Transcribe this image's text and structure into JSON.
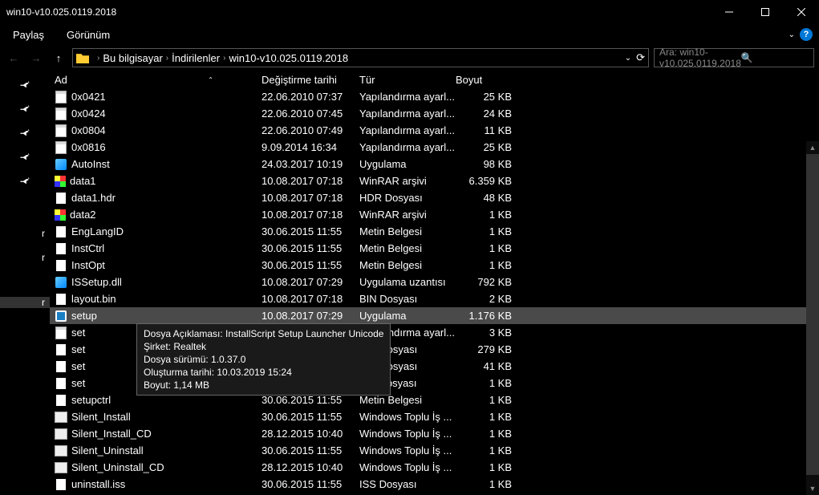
{
  "window": {
    "title": "win10-v10.025.0119.2018"
  },
  "menubar": {
    "share": "Paylaş",
    "view": "Görünüm"
  },
  "breadcrumb": {
    "seg1": "Bu bilgisayar",
    "seg2": "İndirilenler",
    "seg3": "win10-v10.025.0119.2018"
  },
  "search": {
    "placeholder": "Ara: win10-v10.025.0119.2018"
  },
  "columns": {
    "name": "Ad",
    "date": "Değiştirme tarihi",
    "type": "Tür",
    "size": "Boyut"
  },
  "sidebar_fragments": {
    "a": "r",
    "b": "r",
    "c": "r"
  },
  "tooltip": {
    "l1": "Dosya Açıklaması: InstallScript Setup Launcher Unicode",
    "l2": "Şirket: Realtek",
    "l3": "Dosya sürümü: 1.0.37.0",
    "l4": "Oluşturma tarihi: 10.03.2019 15:24",
    "l5": "Boyut: 1,14 MB"
  },
  "files": [
    {
      "icon": "config",
      "name": "0x0421",
      "date": "22.06.2010 07:37",
      "type": "Yapılandırma ayarl...",
      "size": "25 KB"
    },
    {
      "icon": "config",
      "name": "0x0424",
      "date": "22.06.2010 07:45",
      "type": "Yapılandırma ayarl...",
      "size": "24 KB"
    },
    {
      "icon": "config",
      "name": "0x0804",
      "date": "22.06.2010 07:49",
      "type": "Yapılandırma ayarl...",
      "size": "11 KB"
    },
    {
      "icon": "config",
      "name": "0x0816",
      "date": "9.09.2014 16:34",
      "type": "Yapılandırma ayarl...",
      "size": "25 KB"
    },
    {
      "icon": "app",
      "name": "AutoInst",
      "date": "24.03.2017 10:19",
      "type": "Uygulama",
      "size": "98 KB"
    },
    {
      "icon": "rar",
      "name": "data1",
      "date": "10.08.2017 07:18",
      "type": "WinRAR arşivi",
      "size": "6.359 KB"
    },
    {
      "icon": "doc",
      "name": "data1.hdr",
      "date": "10.08.2017 07:18",
      "type": "HDR Dosyası",
      "size": "48 KB"
    },
    {
      "icon": "rar",
      "name": "data2",
      "date": "10.08.2017 07:18",
      "type": "WinRAR arşivi",
      "size": "1 KB"
    },
    {
      "icon": "doc",
      "name": "EngLangID",
      "date": "30.06.2015 11:55",
      "type": "Metin Belgesi",
      "size": "1 KB"
    },
    {
      "icon": "doc",
      "name": "InstCtrl",
      "date": "30.06.2015 11:55",
      "type": "Metin Belgesi",
      "size": "1 KB"
    },
    {
      "icon": "doc",
      "name": "InstOpt",
      "date": "30.06.2015 11:55",
      "type": "Metin Belgesi",
      "size": "1 KB"
    },
    {
      "icon": "app",
      "name": "ISSetup.dll",
      "date": "10.08.2017 07:29",
      "type": "Uygulama uzantısı",
      "size": "792 KB"
    },
    {
      "icon": "doc",
      "name": "layout.bin",
      "date": "10.08.2017 07:18",
      "type": "BIN Dosyası",
      "size": "2 KB"
    },
    {
      "icon": "setup",
      "name": "setup",
      "date": "10.08.2017 07:29",
      "type": "Uygulama",
      "size": "1.176 KB",
      "selected": true
    },
    {
      "icon": "config",
      "name": "set",
      "date": "",
      "type": "Yapılandırma ayarl...",
      "size": "3 KB",
      "partialdate": "8"
    },
    {
      "icon": "doc",
      "name": "set",
      "date": "",
      "type": "INX Dosyası",
      "size": "279 KB",
      "partialdate": "8"
    },
    {
      "icon": "doc",
      "name": "set",
      "date": "",
      "type": "ISN Dosyası",
      "size": "41 KB",
      "partialdate": "7"
    },
    {
      "icon": "doc",
      "name": "set",
      "date": "",
      "type": "ISS Dosyası",
      "size": "1 KB",
      "partialdate": "5"
    },
    {
      "icon": "doc",
      "name": "setupctrl",
      "date": "30.06.2015 11:55",
      "type": "Metin Belgesi",
      "size": "1 KB"
    },
    {
      "icon": "bat",
      "name": "Silent_Install",
      "date": "30.06.2015 11:55",
      "type": "Windows Toplu İş ...",
      "size": "1 KB"
    },
    {
      "icon": "bat",
      "name": "Silent_Install_CD",
      "date": "28.12.2015 10:40",
      "type": "Windows Toplu İş ...",
      "size": "1 KB"
    },
    {
      "icon": "bat",
      "name": "Silent_Uninstall",
      "date": "30.06.2015 11:55",
      "type": "Windows Toplu İş ...",
      "size": "1 KB"
    },
    {
      "icon": "bat",
      "name": "Silent_Uninstall_CD",
      "date": "28.12.2015 10:40",
      "type": "Windows Toplu İş ...",
      "size": "1 KB"
    },
    {
      "icon": "doc",
      "name": "uninstall.iss",
      "date": "30.06.2015 11:55",
      "type": "ISS Dosyası",
      "size": "1 KB"
    }
  ]
}
